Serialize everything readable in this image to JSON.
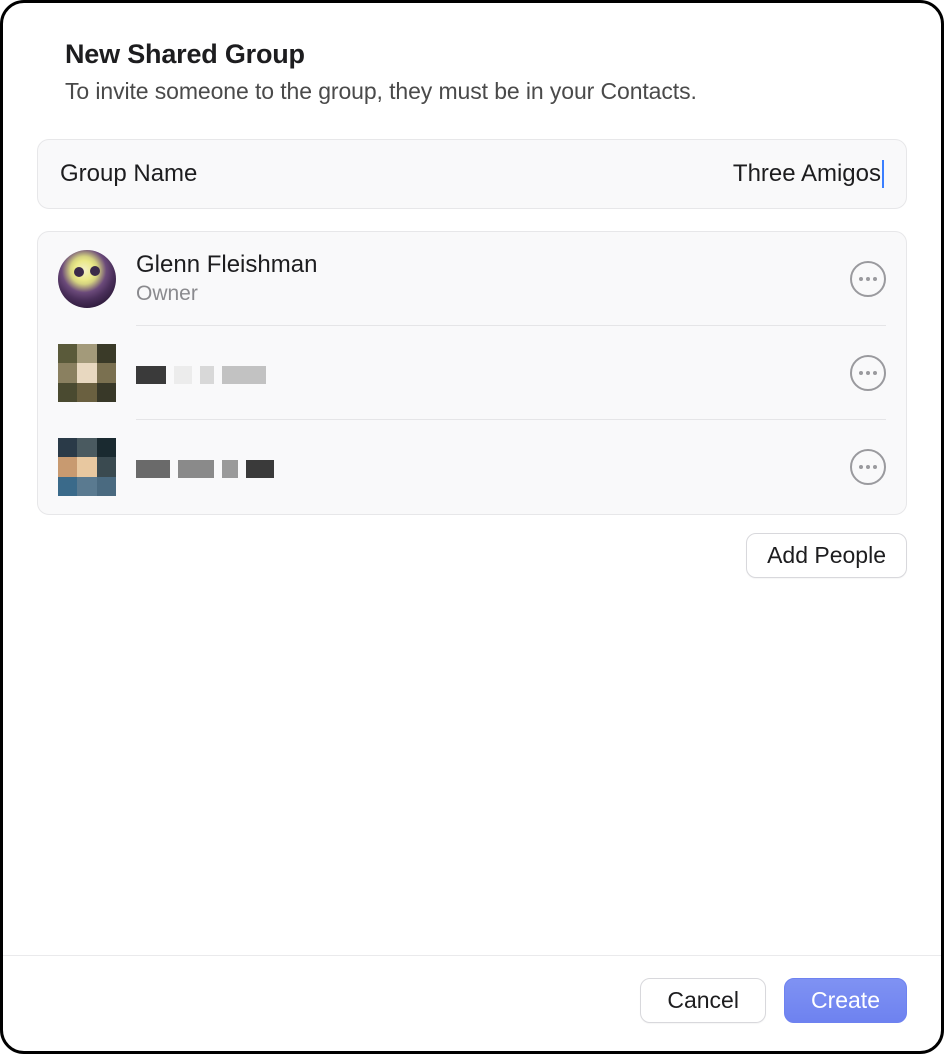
{
  "header": {
    "title": "New Shared Group",
    "subtitle": "To invite someone to the group, they must be in your Contacts."
  },
  "group_name": {
    "label": "Group Name",
    "value": "Three Amigos"
  },
  "people": [
    {
      "name": "Glenn Fleishman",
      "role": "Owner",
      "redacted": false
    },
    {
      "name": "",
      "role": "",
      "redacted": true
    },
    {
      "name": "",
      "role": "",
      "redacted": true
    }
  ],
  "buttons": {
    "add_people": "Add People",
    "cancel": "Cancel",
    "create": "Create"
  }
}
